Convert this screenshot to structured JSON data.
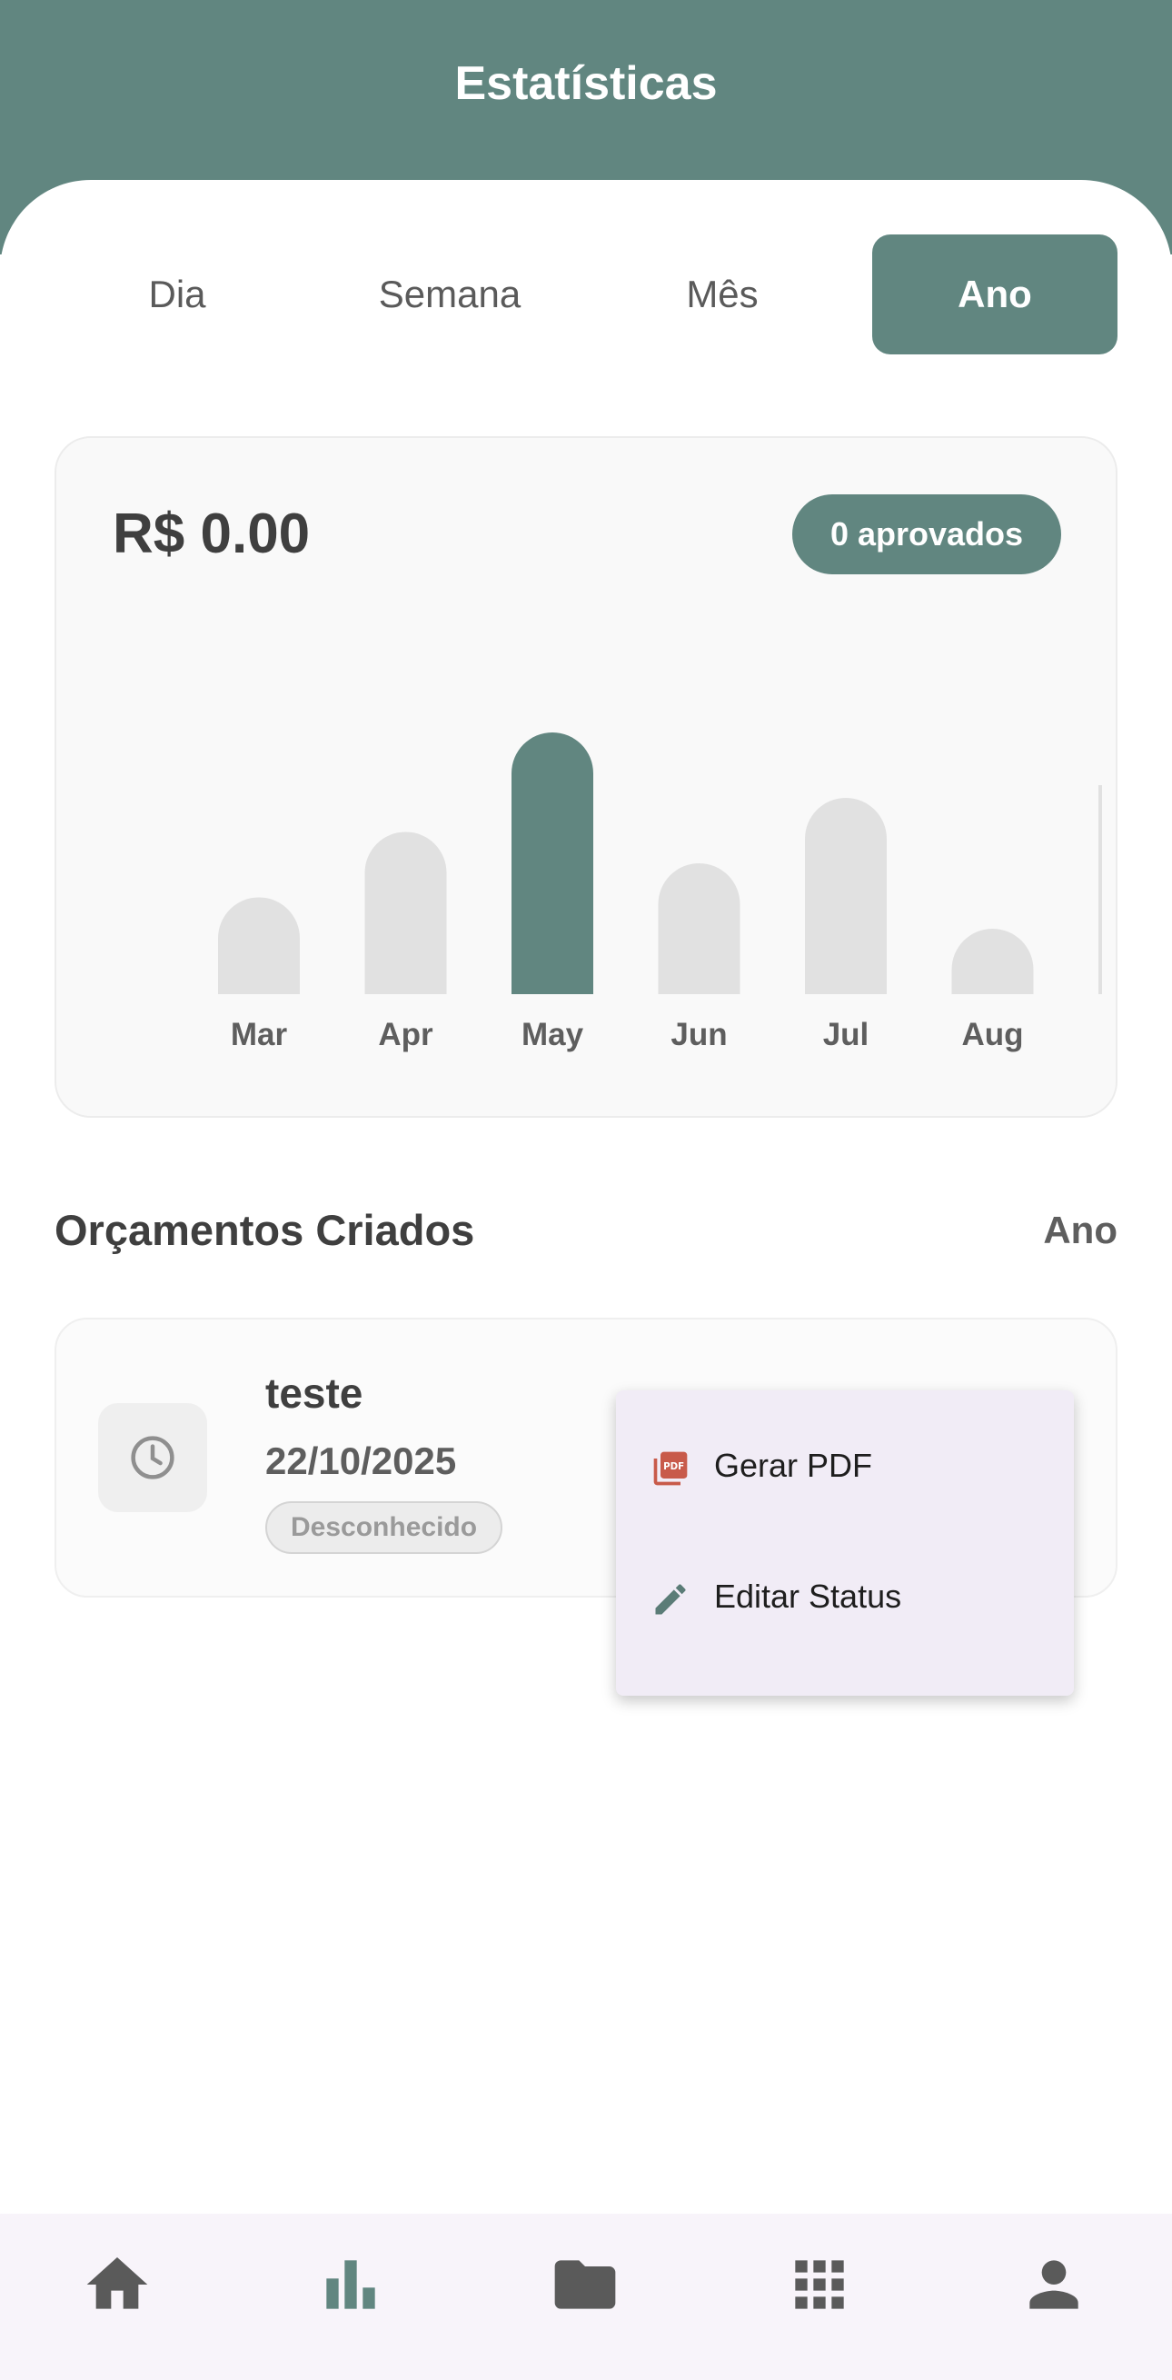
{
  "header": {
    "title": "Estatísticas"
  },
  "tabs": [
    {
      "label": "Dia",
      "active": false
    },
    {
      "label": "Semana",
      "active": false
    },
    {
      "label": "Mês",
      "active": false
    },
    {
      "label": "Ano",
      "active": true
    }
  ],
  "summary": {
    "total": "R$ 0.00",
    "approved_label": "0 aprovados"
  },
  "chart_data": {
    "type": "bar",
    "categories": [
      "Mar",
      "Apr",
      "May",
      "Jun",
      "Jul",
      "Aug"
    ],
    "values": [
      0.37,
      0.62,
      1.0,
      0.5,
      0.75,
      0.25
    ],
    "highlighted": "May",
    "title": "",
    "xlabel": "",
    "ylabel": "",
    "grid": false,
    "colors": {
      "highlight": "#618680",
      "default": "#e1e1e1"
    }
  },
  "section": {
    "title": "Orçamentos Criados",
    "filter_label": "Ano"
  },
  "items": [
    {
      "title": "teste",
      "date": "22/10/2025",
      "status": "Desconhecido",
      "icon": "clock-icon"
    }
  ],
  "context_menu": {
    "items": [
      {
        "label": "Gerar PDF",
        "icon": "pdf-icon"
      },
      {
        "label": "Editar Status",
        "icon": "pencil-icon"
      }
    ]
  },
  "bottom_nav": {
    "items": [
      {
        "name": "home",
        "icon": "home-icon",
        "active": false
      },
      {
        "name": "statistics",
        "icon": "bar-chart-icon",
        "active": true
      },
      {
        "name": "folder",
        "icon": "folder-icon",
        "active": false
      },
      {
        "name": "apps",
        "icon": "grid-icon",
        "active": false
      },
      {
        "name": "profile",
        "icon": "person-icon",
        "active": false
      }
    ]
  },
  "colors": {
    "primary": "#618680",
    "text_dark": "#3f3f3f",
    "text_muted": "#5e5e5e",
    "menu_bg": "#f1ecf6",
    "pdf_red": "#c85a4a"
  }
}
